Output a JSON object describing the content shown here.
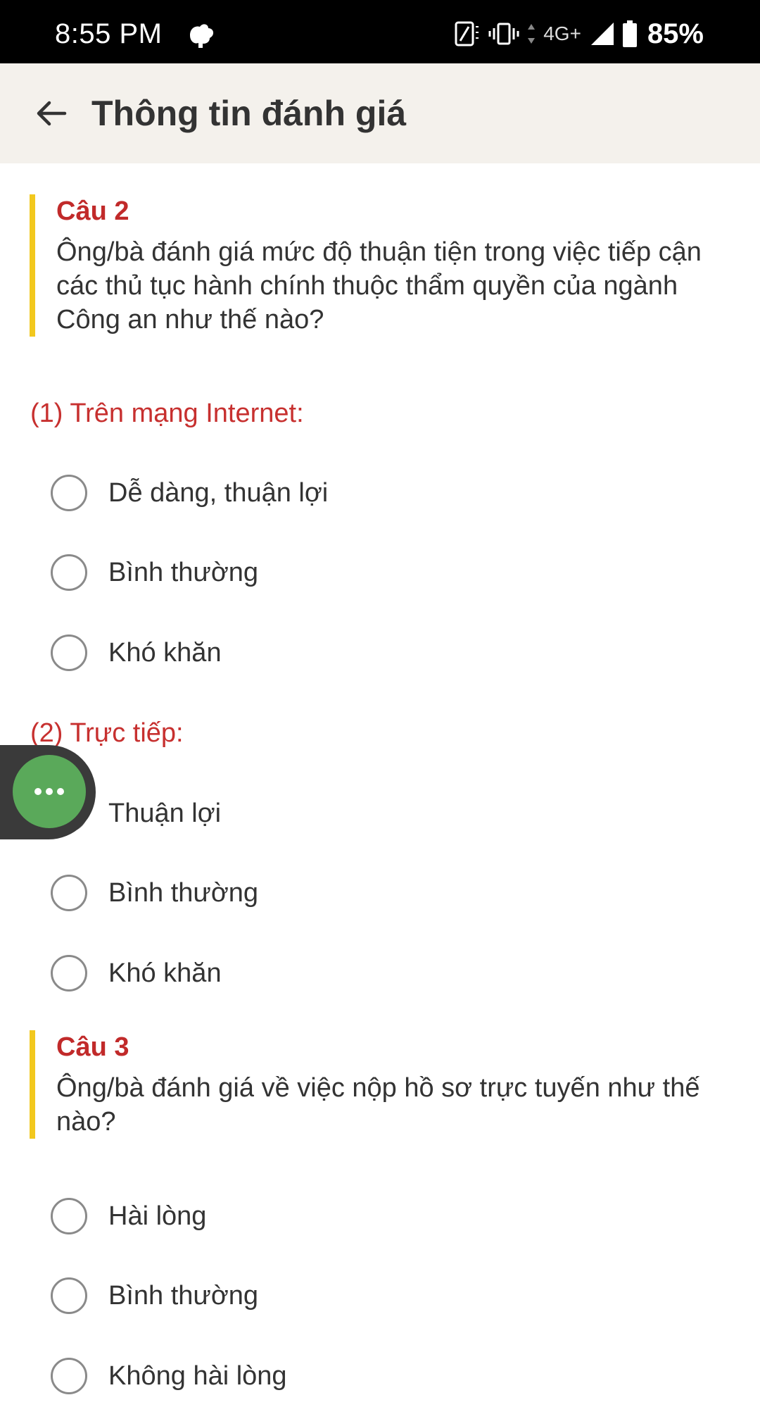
{
  "status_bar": {
    "time": "8:55 PM",
    "network": "4G+",
    "battery": "85%"
  },
  "app_bar": {
    "title": "Thông tin đánh giá"
  },
  "questions": [
    {
      "label": "Câu 2",
      "text": "Ông/bà đánh giá mức độ thuận tiện trong việc tiếp cận các thủ tục hành chính thuộc thẩm quyền của ngành Công an như thế nào?",
      "sections": [
        {
          "label": "(1) Trên mạng Internet:",
          "options": [
            "Dễ dàng, thuận lợi",
            "Bình thường",
            "Khó khăn"
          ]
        },
        {
          "label": "(2) Trực tiếp:",
          "options": [
            "Thuận lợi",
            "Bình thường",
            "Khó khăn"
          ]
        }
      ]
    },
    {
      "label": "Câu 3",
      "text": "Ông/bà đánh giá về việc nộp hồ sơ trực tuyến như thế nào?",
      "options": [
        "Hài lòng",
        "Bình thường",
        "Không hài lòng"
      ]
    }
  ],
  "colors": {
    "accent_red": "#c12a2a",
    "accent_yellow": "#f2c81e",
    "fab_green": "#5aa95a"
  }
}
